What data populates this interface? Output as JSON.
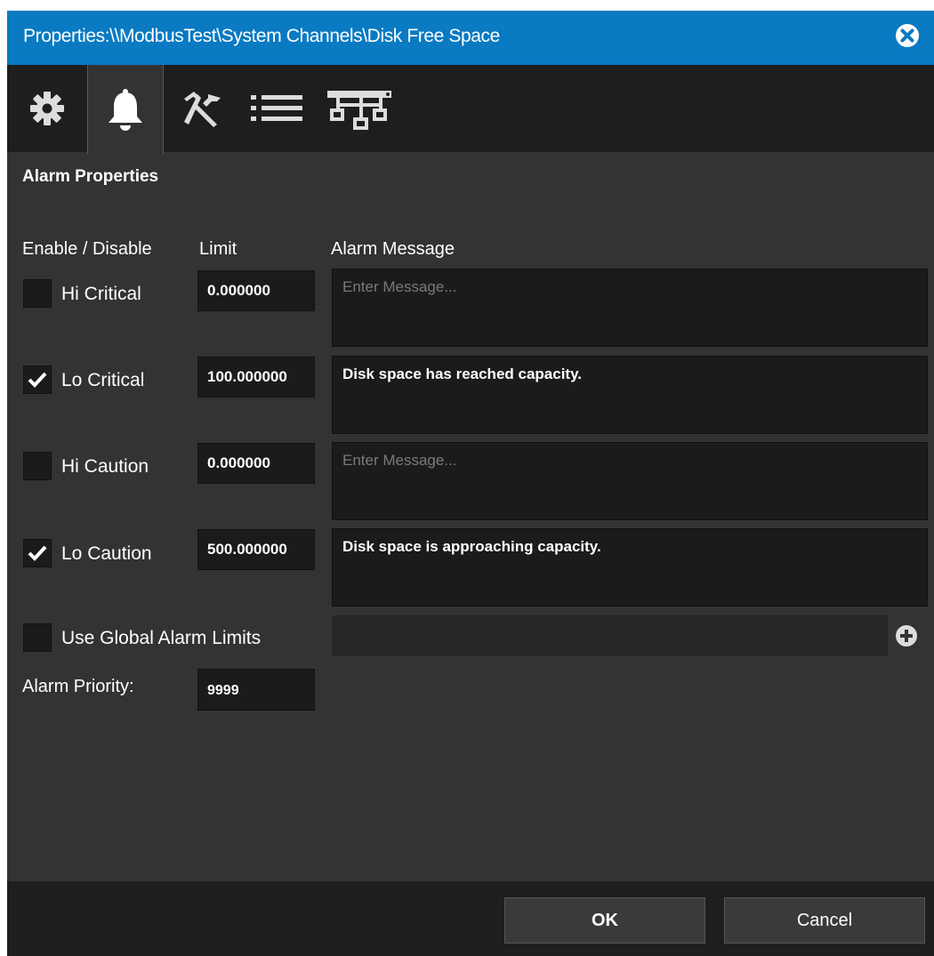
{
  "window": {
    "title": "Properties:\\\\ModbusTest\\System Channels\\Disk Free Space"
  },
  "tabs": [
    {
      "name": "general",
      "icon": "gear-icon"
    },
    {
      "name": "alarms",
      "icon": "bell-icon",
      "active": true
    },
    {
      "name": "tools",
      "icon": "tools-icon"
    },
    {
      "name": "list",
      "icon": "list-icon"
    },
    {
      "name": "network",
      "icon": "network-icon"
    }
  ],
  "section": {
    "title": "Alarm Properties"
  },
  "columns": {
    "enable": "Enable / Disable",
    "limit": "Limit",
    "message": "Alarm Message"
  },
  "alarms": [
    {
      "label": "Hi Critical",
      "checked": false,
      "limit": "0.000000",
      "message": "",
      "placeholder": "Enter Message..."
    },
    {
      "label": "Lo Critical",
      "checked": true,
      "limit": "100.000000",
      "message": "Disk space has reached capacity.",
      "placeholder": ""
    },
    {
      "label": "Hi Caution",
      "checked": false,
      "limit": "0.000000",
      "message": "",
      "placeholder": "Enter Message..."
    },
    {
      "label": "Lo Caution",
      "checked": true,
      "limit": "500.000000",
      "message": "Disk space is approaching capacity.",
      "placeholder": ""
    }
  ],
  "global_limits": {
    "label": "Use Global Alarm Limits",
    "checked": false,
    "value": ""
  },
  "priority": {
    "label": "Alarm Priority:",
    "value": "9999"
  },
  "buttons": {
    "ok": "OK",
    "cancel": "Cancel"
  },
  "colors": {
    "titlebar": "#0a7ac2",
    "panel": "#333333",
    "field": "#1b1b1b",
    "bar": "#1e1e1e"
  }
}
